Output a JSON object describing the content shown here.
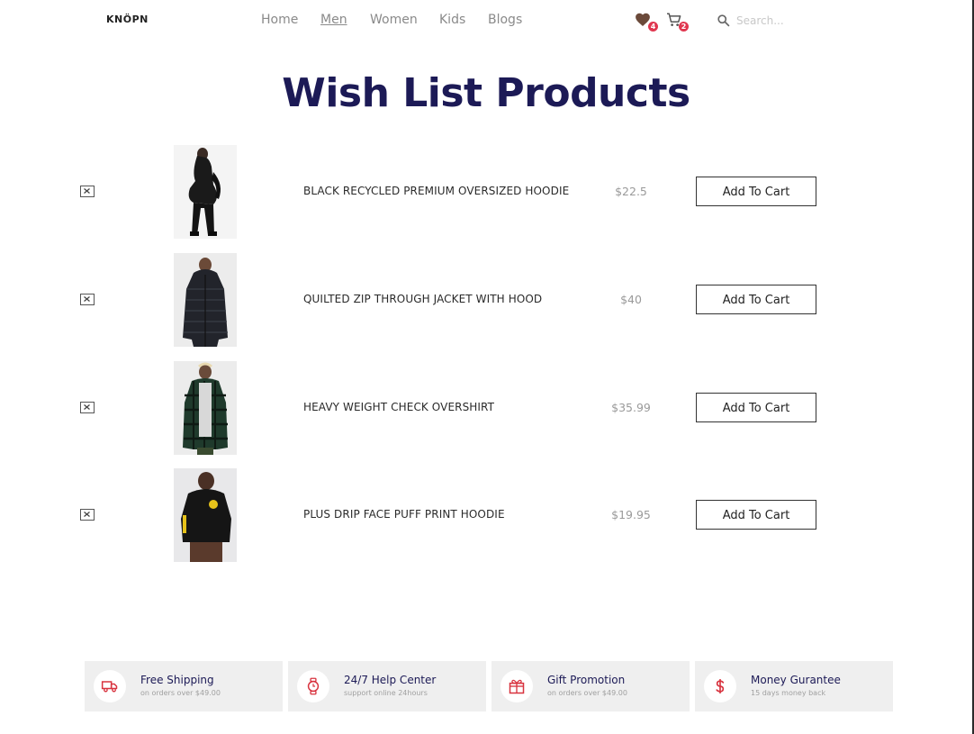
{
  "header": {
    "logo": "KNÖPN",
    "nav": [
      "Home",
      "Men",
      "Women",
      "Kids",
      "Blogs"
    ],
    "wishlist_count": "4",
    "cart_count": "2",
    "search_placeholder": "Search..."
  },
  "page": {
    "title": "Wish List Products"
  },
  "products": [
    {
      "name": "BLACK RECYCLED PREMIUM OVERSIZED HOODIE",
      "price": "$22.5",
      "button": "Add To Cart"
    },
    {
      "name": "QUILTED ZIP THROUGH JACKET WITH HOOD",
      "price": "$40",
      "button": "Add To Cart"
    },
    {
      "name": "HEAVY WEIGHT CHECK OVERSHIRT",
      "price": "$35.99",
      "button": "Add To Cart"
    },
    {
      "name": "PLUS DRIP FACE PUFF PRINT HOODIE",
      "price": "$19.95",
      "button": "Add To Cart"
    }
  ],
  "features": [
    {
      "title": "Free Shipping",
      "subtitle": "on orders over $49.00",
      "icon": "truck-icon"
    },
    {
      "title": "24/7 Help Center",
      "subtitle": "support online 24hours",
      "icon": "watch-icon"
    },
    {
      "title": "Gift Promotion",
      "subtitle": "on orders over $49.00",
      "icon": "gift-icon"
    },
    {
      "title": "Money Gurantee",
      "subtitle": "15 days money back",
      "icon": "dollar-icon"
    }
  ],
  "colors": {
    "title": "#1c1a56",
    "badge": "#e0364f",
    "feature_icon": "#d8333f",
    "heart": "#6b4a3a"
  }
}
